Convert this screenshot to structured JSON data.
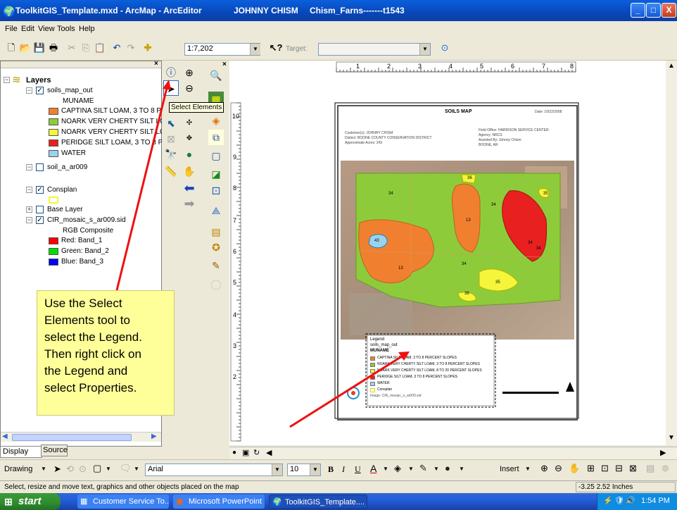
{
  "window": {
    "app_title": "ToolkitGIS_Template.mxd - ArcMap - ArcEditor",
    "user": "JOHNNY CHISM",
    "farm": "Chism_Farns-------t1543",
    "controls": [
      "_",
      "□",
      "X"
    ]
  },
  "menu": [
    "File",
    "Edit",
    "View",
    "Tools",
    "Help"
  ],
  "toolbar": {
    "scale": "1:7,202",
    "target_label": "Target:",
    "target_value": ""
  },
  "toc": {
    "header": "Layers",
    "items": [
      {
        "label": "soils_map_out",
        "checked": "☑"
      },
      {
        "label": "MUNAME"
      },
      {
        "label": "CAPTINA SILT LOAM, 3 TO 8 P",
        "color": "#f08030"
      },
      {
        "label": "NOARK VERY CHERTY SILT LO.",
        "color": "#8ecb3a"
      },
      {
        "label": "NOARK VERY CHERTY SILT LO",
        "color": "#f5f53b"
      },
      {
        "label": "PERIDGE SILT LOAM, 3 TO 8 P",
        "color": "#e82020"
      },
      {
        "label": "WATER",
        "color": "#9ad2f0"
      },
      {
        "label": "soil_a_ar009",
        "checked": "□"
      },
      {
        "label": "Consplan",
        "checked": "☑"
      },
      {
        "label": "Base Layer",
        "checked": "□"
      },
      {
        "label": "CIR_mosaic_s_ar009.sid",
        "checked": "☑"
      },
      {
        "label": "RGB Composite"
      },
      {
        "label": "Red:   Band_1",
        "color": "#ff0000"
      },
      {
        "label": "Green: Band_2",
        "color": "#00dd00"
      },
      {
        "label": "Blue:  Band_3",
        "color": "#0000ff"
      }
    ],
    "tabs": [
      "Display",
      "Source"
    ]
  },
  "tooltip": "Select Elements",
  "callout": "Use the Select\nElements tool to\nselect the Legend.\nThen right click on\nthe Legend and\nselect Properties.",
  "ruler": {
    "top": [
      "1",
      "2",
      "3",
      "4",
      "5",
      "6",
      "7",
      "8"
    ],
    "left": [
      "10",
      "9",
      "8",
      "7",
      "6",
      "5",
      "4",
      "3",
      "2"
    ]
  },
  "map": {
    "title": "SOILS MAP",
    "date": "Date: 10/22/2008",
    "info_left": [
      "Customer(s): JOHNNY CHISM",
      "District: BOONE COUNTY CONSERVATION DISTRICT",
      "Approximate Acres: 243"
    ],
    "info_right": [
      "Field Office: HARRISON SERVICE CENTER",
      "Agency: NRCS",
      "Assisted By: Johnny Chism",
      "BOONE, AR"
    ],
    "labels": [
      "34",
      "36",
      "35",
      "34",
      "13",
      "34",
      "43",
      "34",
      "13",
      "34",
      "36",
      "35"
    ],
    "legend": {
      "title": "Legend",
      "layer": "soils_map_out",
      "field": "MUNAME",
      "items": [
        {
          "label": "CAPTINA SILT LOAM, 3 TO 8 PERCENT SLOPES",
          "color": "#f08030"
        },
        {
          "label": "NOARK VERY CHERTY SILT LOAM, 3 TO 8 PERCENT SLOPES",
          "color": "#8ecb3a"
        },
        {
          "label": "NOARK VERY CHERTY SILT LOAM, 8 TO 20 PERCENT SLOPES",
          "color": "#f5f53b"
        },
        {
          "label": "PERIDGE SILT LOAM, 3 TO 8 PERCENT SLOPES",
          "color": "#e82020"
        },
        {
          "label": "WATER",
          "color": "#9ad2f0"
        },
        {
          "label": "Consplan",
          "color": "#ffffff"
        }
      ],
      "image": "Image: CIR_mosaic_s_ar009.sid"
    }
  },
  "drawing_toolbar": {
    "drawing": "Drawing",
    "font": "Arial",
    "size": "10",
    "insert": "Insert"
  },
  "status": {
    "message": "Select, resize and move text, graphics and other objects placed on the map",
    "coords": "-3.25  2.52 Inches"
  },
  "taskbar": {
    "start": "start",
    "tasks": [
      "Customer Service To...",
      "Microsoft PowerPoint ...",
      "ToolkitGIS_Template...."
    ],
    "time": "1:54 PM"
  }
}
